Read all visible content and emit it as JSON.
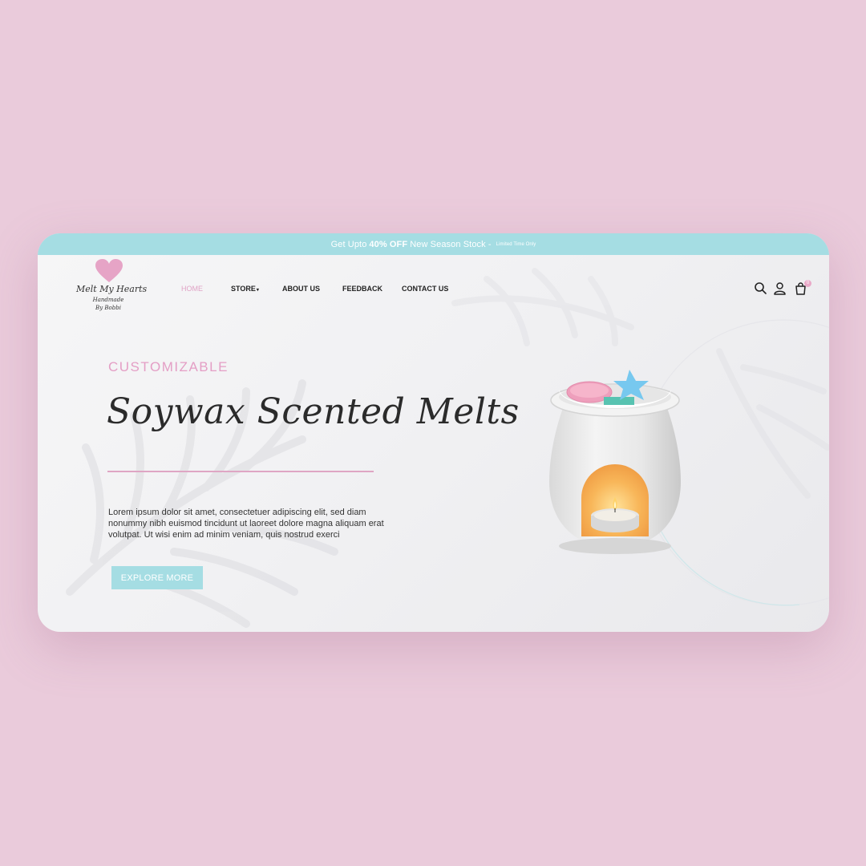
{
  "promo": {
    "prefix": "Get Upto",
    "highlight": "40% OFF",
    "suffix": "New Season Stock -",
    "note": "Limited Time Only"
  },
  "brand": {
    "name": "Melt My Hearts",
    "line1": "Handmade",
    "line2": "By Bobbi"
  },
  "nav": {
    "home": "HOME",
    "store": "STORE",
    "about": "ABOUT US",
    "feedback": "FEEDBACK",
    "contact": "CONTACT US",
    "active": "HOME"
  },
  "header_icons": [
    "search-icon",
    "user-icon",
    "cart-icon"
  ],
  "cart_count": "0",
  "hero": {
    "eyebrow": "CUSTOMIZABLE",
    "title": "Soywax Scented Melts",
    "body": "Lorem ipsum dolor sit amet, consectetuer adipiscing elit, sed diam nonummy nibh euismod tincidunt ut laoreet dolore magna aliquam erat volutpat. Ut wisi enim ad minim veniam, quis nostrud exerci",
    "cta": "EXPLORE MORE"
  },
  "colors": {
    "page_bg": "#eacbdb",
    "accent_teal": "#a5dde3",
    "accent_pink": "#e49ec5"
  }
}
